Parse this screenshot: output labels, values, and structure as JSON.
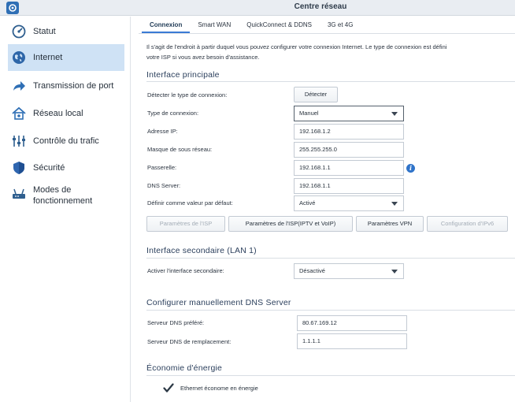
{
  "window": {
    "title": "Centre réseau"
  },
  "sidebar": {
    "items": [
      {
        "label": "Statut",
        "icon": "status-icon"
      },
      {
        "label": "Internet",
        "icon": "globe-icon",
        "active": true
      },
      {
        "label": "Transmission de port",
        "icon": "port-forward-icon"
      },
      {
        "label": "Réseau local",
        "icon": "home-network-icon"
      },
      {
        "label": "Contrôle du trafic",
        "icon": "traffic-control-icon"
      },
      {
        "label": "Sécurité",
        "icon": "shield-icon"
      },
      {
        "label_line1": "Modes de",
        "label_line2": "fonctionnement",
        "icon": "router-mode-icon"
      }
    ]
  },
  "tabs": [
    {
      "label": "Connexion",
      "active": true
    },
    {
      "label": "Smart WAN"
    },
    {
      "label": "QuickConnect & DDNS"
    },
    {
      "label": "3G et 4G"
    }
  ],
  "description": {
    "line1": "Il s'agit de l'endroit à partir duquel vous pouvez configurer votre connexion Internet. Le type de connexion est défini",
    "line2": "votre ISP si vous avez besoin d'assistance."
  },
  "primary": {
    "title": "Interface principale",
    "detect_label": "Détecter le type de connexion:",
    "detect_button": "Détecter",
    "conn_type_label": "Type de connexion:",
    "conn_type_value": "Manuel",
    "ip_label": "Adresse IP:",
    "ip_value": "192.168.1.2",
    "mask_label": "Masque de sous réseau:",
    "mask_value": "255.255.255.0",
    "gateway_label": "Passerelle:",
    "gateway_value": "192.168.1.1",
    "dns_label": "DNS Server:",
    "dns_value": "192.168.1.1",
    "default_label": "Définir comme valeur par défaut:",
    "default_value": "Activé",
    "buttons": {
      "isp": "Paramètres de l'ISP",
      "isp_iptv": "Paramètres de l'ISP(IPTV et VoIP)",
      "vpn": "Paramètres VPN",
      "ipv6": "Configuration d'IPv6"
    }
  },
  "secondary": {
    "title": "Interface secondaire (LAN 1)",
    "enable_label": "Activer l'interface secondaire:",
    "enable_value": "Désactivé"
  },
  "dns_manual": {
    "title": "Configurer manuellement DNS Server",
    "preferred_label": "Serveur DNS préféré:",
    "preferred_value": "80.67.169.12",
    "alternate_label": "Serveur DNS de remplacement:",
    "alternate_value": "1.1.1.1"
  },
  "energy": {
    "title": "Économie d'énergie",
    "eee_label": "Ethernet économe en énergie",
    "eee_checked": true
  },
  "colors": {
    "accent": "#3a7bd5",
    "active_item_bg": "#cfe2f5",
    "section_title": "#2b3f5c"
  }
}
